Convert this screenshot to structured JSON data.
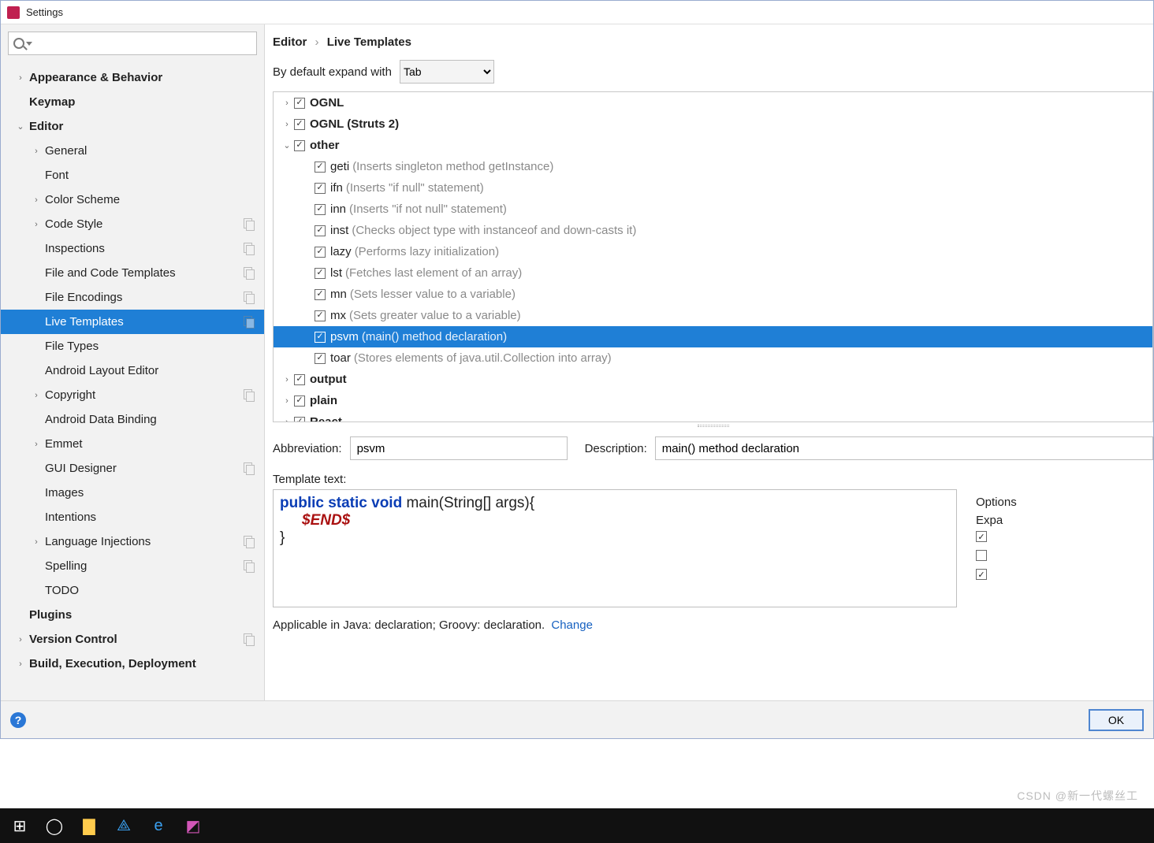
{
  "window": {
    "title": "Settings"
  },
  "sidebar": {
    "items": [
      {
        "label": "Appearance & Behavior",
        "level": 1,
        "exp": "›",
        "bold": true
      },
      {
        "label": "Keymap",
        "level": 1,
        "exp": "",
        "bold": true,
        "noexp": true
      },
      {
        "label": "Editor",
        "level": 1,
        "exp": "⌄",
        "bold": true
      },
      {
        "label": "General",
        "level": 2,
        "exp": "›"
      },
      {
        "label": "Font",
        "level": 2,
        "exp": "",
        "noexp": true
      },
      {
        "label": "Color Scheme",
        "level": 2,
        "exp": "›"
      },
      {
        "label": "Code Style",
        "level": 2,
        "exp": "›",
        "copy": true
      },
      {
        "label": "Inspections",
        "level": 2,
        "exp": "",
        "noexp": true,
        "copy": true
      },
      {
        "label": "File and Code Templates",
        "level": 2,
        "exp": "",
        "noexp": true,
        "copy": true
      },
      {
        "label": "File Encodings",
        "level": 2,
        "exp": "",
        "noexp": true,
        "copy": true
      },
      {
        "label": "Live Templates",
        "level": 2,
        "exp": "",
        "noexp": true,
        "copy": true,
        "selected": true
      },
      {
        "label": "File Types",
        "level": 2,
        "exp": "",
        "noexp": true
      },
      {
        "label": "Android Layout Editor",
        "level": 2,
        "exp": "",
        "noexp": true
      },
      {
        "label": "Copyright",
        "level": 2,
        "exp": "›",
        "copy": true
      },
      {
        "label": "Android Data Binding",
        "level": 2,
        "exp": "",
        "noexp": true
      },
      {
        "label": "Emmet",
        "level": 2,
        "exp": "›"
      },
      {
        "label": "GUI Designer",
        "level": 2,
        "exp": "",
        "noexp": true,
        "copy": true
      },
      {
        "label": "Images",
        "level": 2,
        "exp": "",
        "noexp": true
      },
      {
        "label": "Intentions",
        "level": 2,
        "exp": "",
        "noexp": true
      },
      {
        "label": "Language Injections",
        "level": 2,
        "exp": "›",
        "copy": true
      },
      {
        "label": "Spelling",
        "level": 2,
        "exp": "",
        "noexp": true,
        "copy": true
      },
      {
        "label": "TODO",
        "level": 2,
        "exp": "",
        "noexp": true
      },
      {
        "label": "Plugins",
        "level": 1,
        "exp": "",
        "bold": true,
        "noexp": true
      },
      {
        "label": "Version Control",
        "level": 1,
        "exp": "›",
        "bold": true,
        "copy": true
      },
      {
        "label": "Build, Execution, Deployment",
        "level": 1,
        "exp": "›",
        "bold": true
      }
    ]
  },
  "breadcrumb": {
    "a": "Editor",
    "b": "Live Templates"
  },
  "expand": {
    "label": "By default expand with",
    "value": "Tab"
  },
  "templates": [
    {
      "indent": 1,
      "exp": "›",
      "name": "OGNL",
      "bold": true
    },
    {
      "indent": 1,
      "exp": "›",
      "name": "OGNL (Struts 2)",
      "bold": true
    },
    {
      "indent": 1,
      "exp": "⌄",
      "name": "other",
      "bold": true
    },
    {
      "indent": 2,
      "name": "geti",
      "hint": "(Inserts singleton method getInstance)"
    },
    {
      "indent": 2,
      "name": "ifn",
      "hint": "(Inserts \"if null\" statement)"
    },
    {
      "indent": 2,
      "name": "inn",
      "hint": "(Inserts \"if not null\" statement)"
    },
    {
      "indent": 2,
      "name": "inst",
      "hint": "(Checks object type with instanceof and down-casts it)"
    },
    {
      "indent": 2,
      "name": "lazy",
      "hint": "(Performs lazy initialization)"
    },
    {
      "indent": 2,
      "name": "lst",
      "hint": "(Fetches last element of an array)"
    },
    {
      "indent": 2,
      "name": "mn",
      "hint": "(Sets lesser value to a variable)"
    },
    {
      "indent": 2,
      "name": "mx",
      "hint": "(Sets greater value to a variable)"
    },
    {
      "indent": 2,
      "name": "psvm",
      "hint": "(main() method declaration)",
      "selected": true
    },
    {
      "indent": 2,
      "name": "toar",
      "hint": "(Stores elements of java.util.Collection into array)"
    },
    {
      "indent": 1,
      "exp": "›",
      "name": "output",
      "bold": true
    },
    {
      "indent": 1,
      "exp": "›",
      "name": "plain",
      "bold": true
    },
    {
      "indent": 1,
      "exp": "›",
      "name": "React",
      "bold": true
    }
  ],
  "form": {
    "abbr_label": "Abbreviation:",
    "abbr_value": "psvm",
    "desc_label": "Description:",
    "desc_value": "main() method declaration",
    "template_label": "Template text:"
  },
  "code": {
    "line1_kw": "public static void",
    "line1_rest": " main(String[] args){",
    "line2_var": "$END$",
    "line3": "}"
  },
  "options": {
    "header": "Options",
    "expand_label": "Expa",
    "rows": [
      {
        "chk": true
      },
      {
        "chk": false
      },
      {
        "chk": true
      }
    ]
  },
  "applicable": {
    "text": "Applicable in Java: declaration; Groovy: declaration.",
    "link": "Change"
  },
  "footer": {
    "ok": "OK"
  },
  "watermark": "CSDN @新一代螺丝工"
}
